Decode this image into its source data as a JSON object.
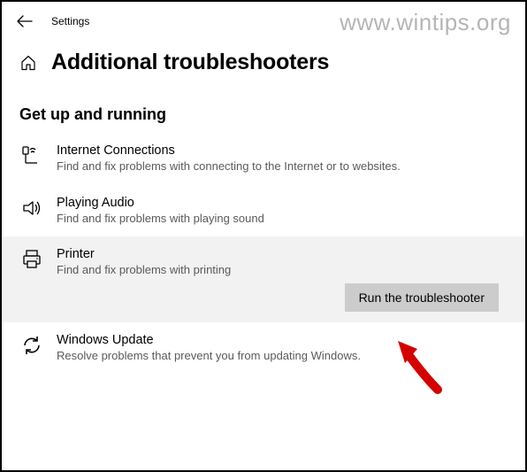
{
  "topbar": {
    "settings_label": "Settings"
  },
  "watermark": "www.wintips.org",
  "header": {
    "title": "Additional troubleshooters"
  },
  "section": {
    "title": "Get up and running"
  },
  "items": [
    {
      "title": "Internet Connections",
      "desc": "Find and fix problems with connecting to the Internet or to websites."
    },
    {
      "title": "Playing Audio",
      "desc": "Find and fix problems with playing sound"
    },
    {
      "title": "Printer",
      "desc": "Find and fix problems with printing"
    },
    {
      "title": "Windows Update",
      "desc": "Resolve problems that prevent you from updating Windows."
    }
  ],
  "run_button": "Run the troubleshooter"
}
